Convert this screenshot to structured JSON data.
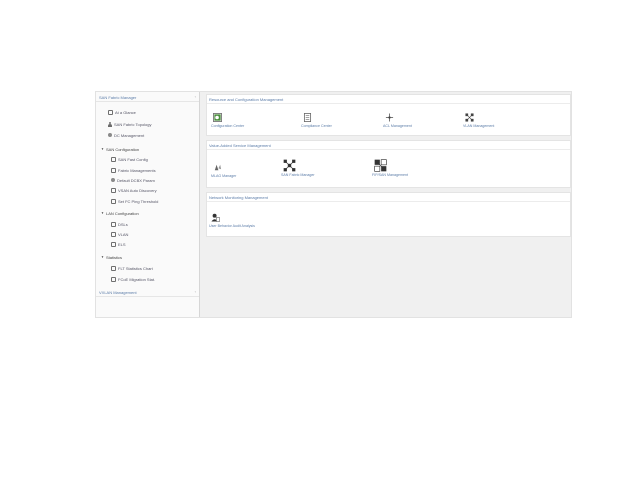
{
  "sidebar": {
    "sections": [
      {
        "header": "SAN Fabric Manager",
        "chevron": "‹"
      },
      {
        "header": "VXLAN Management",
        "chevron": "‹"
      }
    ],
    "top_items": [
      {
        "label": "At a Glance",
        "icon": "dashboard-icon"
      },
      {
        "label": "SAN Fabric Topology",
        "icon": "topology-icon"
      },
      {
        "label": "DC Management",
        "icon": "dc-icon"
      }
    ],
    "groups": [
      {
        "label": "SAN Configuration",
        "items": [
          "SAN Fast Config",
          "Fabric Managements",
          "Default DCBX Param",
          "VSAN Auto Discovery",
          "Set FC Ping Threshold"
        ]
      },
      {
        "label": "LAN Configuration",
        "items": [
          "DSLs",
          "VLAN",
          "ELS"
        ]
      },
      {
        "label": "Statistics",
        "items": [
          "FLT Statistics Chart",
          "FCoE Migration Stat."
        ]
      }
    ]
  },
  "panels": [
    {
      "title": "Resource and Configuration Management",
      "tiles": [
        {
          "label": "Configuration Center",
          "icon": "config-center-icon"
        },
        {
          "label": "Compliance Center",
          "icon": "compliance-icon"
        },
        {
          "label": "ACL Management",
          "icon": "acl-icon"
        },
        {
          "label": "VLAN Management",
          "icon": "vlan-icon"
        }
      ]
    },
    {
      "title": "Value-Added Service Management",
      "tiles": [
        {
          "label": "MLAG Manager",
          "icon": "mlag-icon"
        },
        {
          "label": "SAN Fabric Manager",
          "icon": "san-fabric-icon"
        },
        {
          "label": "FIP/SAN Management",
          "icon": "fip-icon"
        }
      ]
    },
    {
      "title": "Network Monitoring Management",
      "tiles": [
        {
          "label": "User Behavior Audit Analysis",
          "icon": "user-audit-icon"
        }
      ]
    }
  ],
  "colors": {
    "link": "#5b7ca8",
    "accent_green": "#4a8f3c"
  }
}
